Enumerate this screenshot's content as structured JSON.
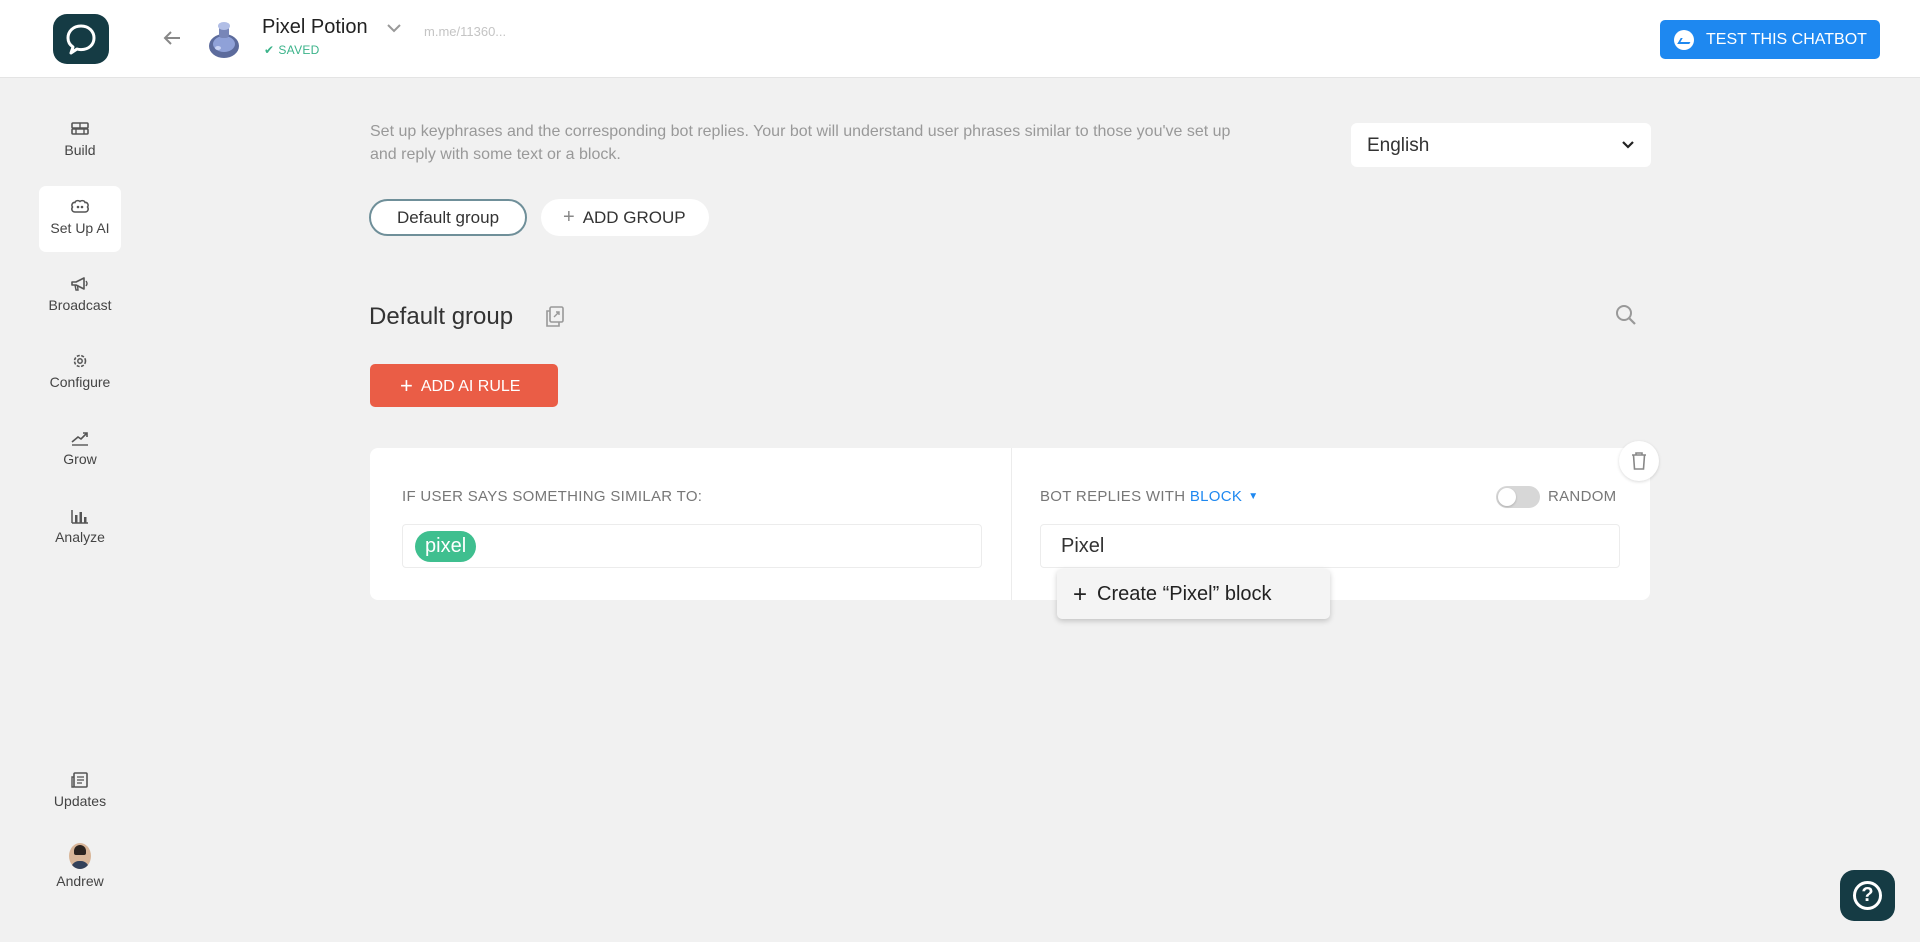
{
  "header": {
    "bot_name": "Pixel Potion",
    "saved_label": "SAVED",
    "bot_link": "m.me/11360...",
    "test_button": "TEST THIS CHATBOT"
  },
  "sidebar": {
    "items": [
      {
        "label": "Build",
        "icon": "bricks-icon"
      },
      {
        "label": "Set Up AI",
        "icon": "brain-icon"
      },
      {
        "label": "Broadcast",
        "icon": "megaphone-icon"
      },
      {
        "label": "Configure",
        "icon": "gear-icon"
      },
      {
        "label": "Grow",
        "icon": "growth-arrow-icon"
      },
      {
        "label": "Analyze",
        "icon": "bar-chart-icon"
      }
    ],
    "bottom": [
      {
        "label": "Updates",
        "icon": "updates-icon"
      },
      {
        "label": "Andrew",
        "icon": "user-avatar"
      }
    ]
  },
  "main": {
    "description": "Set up keyphrases and the corresponding bot replies. Your bot will understand user phrases similar to those you've set up and reply with some text or a block.",
    "language": "English",
    "groups": [
      "Default group"
    ],
    "add_group_label": "ADD GROUP",
    "group_title": "Default group",
    "add_rule_label": "ADD AI RULE"
  },
  "rule": {
    "left_label": "IF USER SAYS SOMETHING SIMILAR TO:",
    "keywords": [
      "pixel"
    ],
    "right_label_prefix": "BOT REPLIES WITH",
    "right_label_mode": "BLOCK",
    "random_label": "RANDOM",
    "reply_value": "Pixel"
  },
  "dropdown": {
    "option": "Create “Pixel” block"
  },
  "colors": {
    "brand_dark": "#153b44",
    "accent_blue": "#1e88f0",
    "accent_red": "#ea5d46",
    "tag_green": "#3fbf8f"
  }
}
